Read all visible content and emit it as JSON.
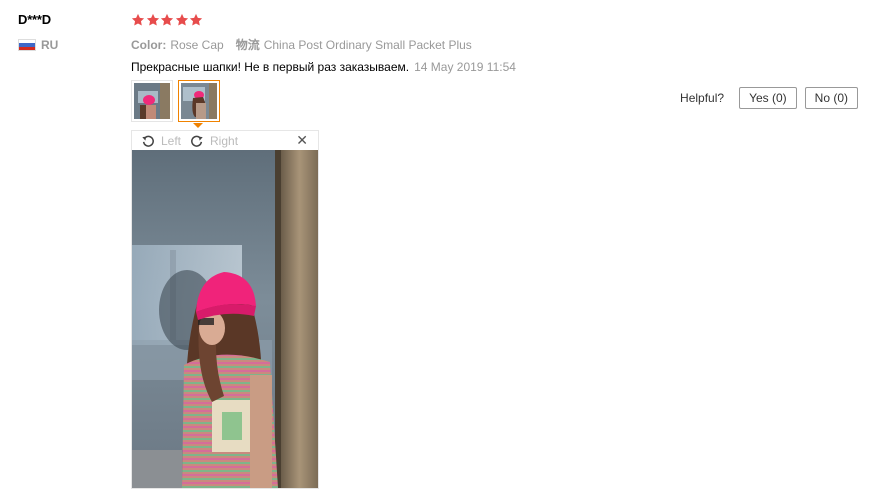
{
  "reviewer": {
    "name": "D***D",
    "country_code": "RU",
    "flag_colors": [
      "#ffffff",
      "#3f68c8",
      "#d52b1e"
    ]
  },
  "review": {
    "rating": 5,
    "max_rating": 5,
    "star_color": "#e74c4c",
    "attributes": [
      {
        "label": "Color:",
        "value": "Rose Cap"
      },
      {
        "label": "物流",
        "value": "China Post Ordinary Small Packet Plus"
      }
    ],
    "text": "Прекрасные шапки! Не в первый раз заказываем.",
    "date": "14 May 2019 11:54"
  },
  "photos": {
    "thumbnails": [
      {
        "name": "photo-1",
        "active": false
      },
      {
        "name": "photo-2",
        "active": true
      }
    ],
    "accent_color": "#f08200"
  },
  "helpful": {
    "label": "Helpful?",
    "yes_label": "Yes (0)",
    "no_label": "No (0)"
  },
  "viewer": {
    "rotate_left_label": "Left",
    "rotate_right_label": "Right",
    "close_icon": "close-icon",
    "close_glyph": "✕",
    "photo_description_icon": "photo-viewer"
  }
}
